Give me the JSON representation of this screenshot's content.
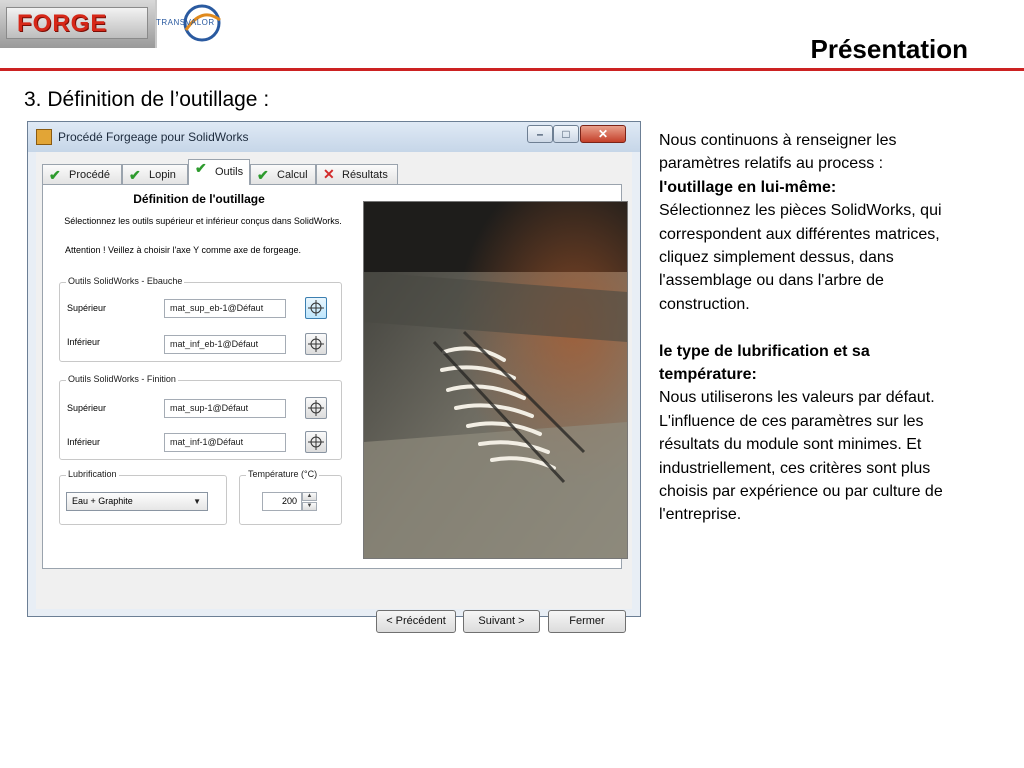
{
  "header": {
    "logo_forge": "FORGE",
    "logo_transvalor": "TRANSVALOR",
    "title": "Présentation",
    "section": "3. Définition de l’outillage :"
  },
  "window": {
    "title": "Procédé Forgeage pour SolidWorks",
    "buttons": {
      "minimize": "–",
      "maximize": "□",
      "close": "✕"
    },
    "tabs": [
      {
        "label": "Procédé",
        "status": "done"
      },
      {
        "label": "Lopin",
        "status": "done"
      },
      {
        "label": "Outils",
        "status": "done",
        "active": true
      },
      {
        "label": "Calcul",
        "status": "done"
      },
      {
        "label": "Résultats",
        "status": "error"
      }
    ],
    "panel": {
      "title": "Définition de l'outillage",
      "instruction": "Sélectionnez les outils supérieur et inférieur conçus dans SolidWorks.",
      "attention": "Attention ! Veillez à choisir l'axe Y comme axe de forgeage.",
      "group_rough": {
        "label": "Outils SolidWorks - Ebauche",
        "upper_label": "Supérieur",
        "upper_value": "mat_sup_eb-1@Défaut",
        "lower_label": "Inférieur",
        "lower_value": "mat_inf_eb-1@Défaut"
      },
      "group_finish": {
        "label": "Outils SolidWorks - Finition",
        "upper_label": "Supérieur",
        "upper_value": "mat_sup-1@Défaut",
        "lower_label": "Inférieur",
        "lower_value": "mat_inf-1@Défaut"
      },
      "lubrication": {
        "label": "Lubrification",
        "selected": "Eau + Graphite"
      },
      "temperature": {
        "label": "Température (°C)",
        "value": "200"
      }
    },
    "footer": {
      "previous": "< Précédent",
      "next": "Suivant >",
      "close": "Fermer"
    }
  },
  "notes": {
    "intro": "Nous continuons à renseigner les paramètres relatifs au process :",
    "tooling_heading": "l'outillage en lui-même:",
    "tooling_text": "Sélectionnez les pièces SolidWorks, qui correspondent aux différentes matrices, cliquez simplement dessus, dans l'assemblage ou dans l'arbre de construction.",
    "lubrication_heading": "le type de lubrification et sa température:",
    "lubrication_text": "Nous utiliserons les valeurs par défaut. L'influence de ces paramètres sur les résultats du module sont minimes. Et industriellement, ces critères sont plus choisis par expérience ou par culture de l'entreprise."
  },
  "colors": {
    "rule": "#cc2222",
    "logo_red": "#d62718",
    "check_green": "#2e9b2e",
    "error_red": "#d22b2b"
  }
}
